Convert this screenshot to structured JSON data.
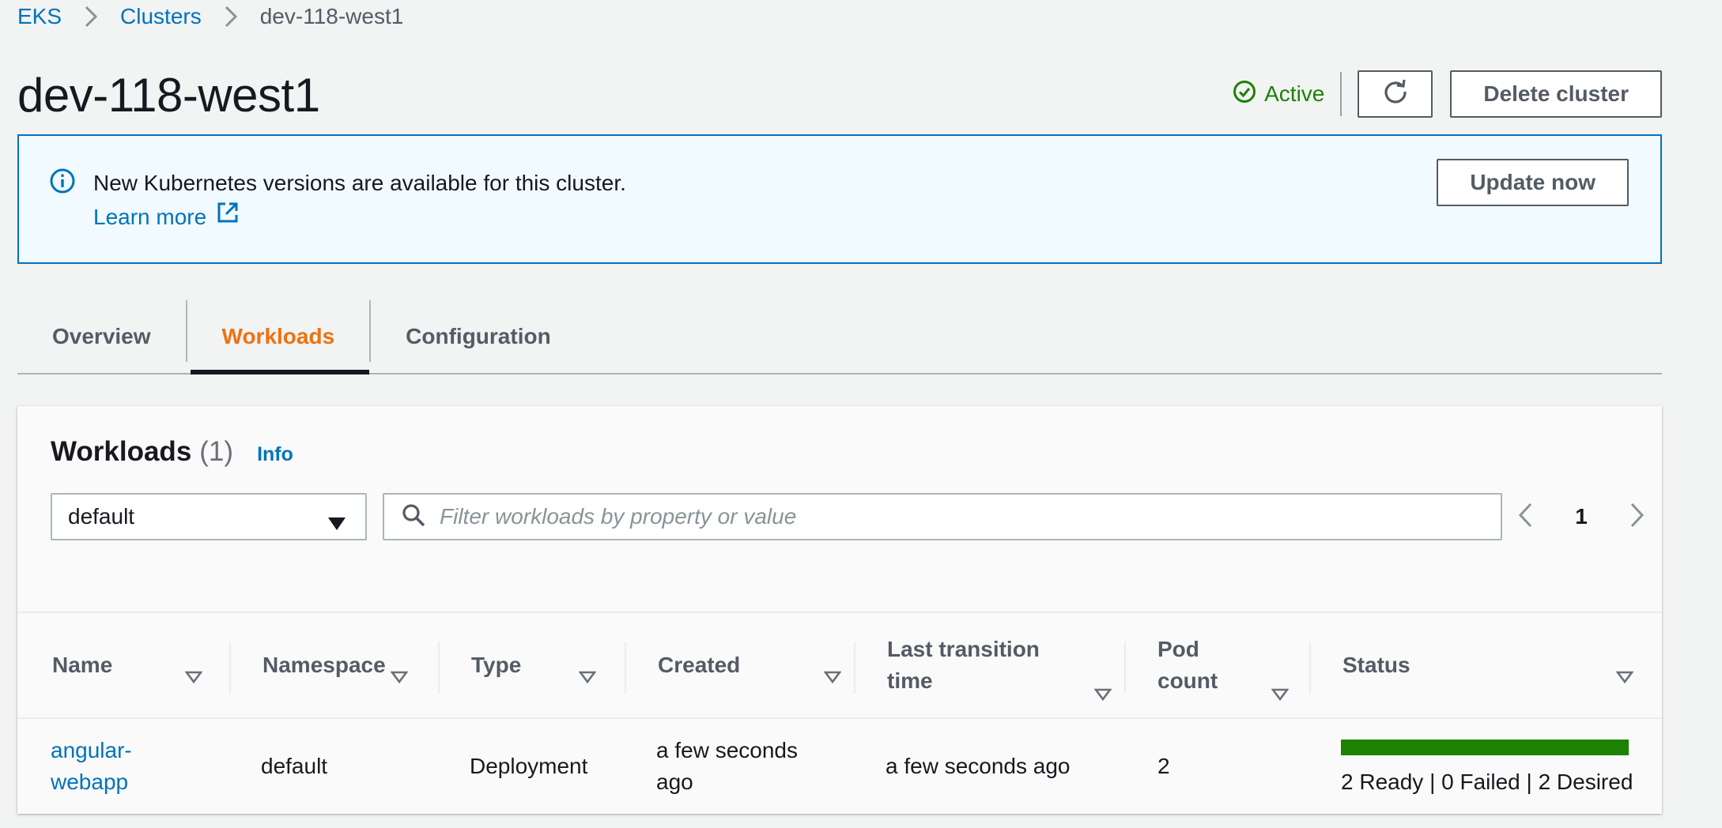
{
  "breadcrumb": {
    "items": [
      "EKS",
      "Clusters"
    ],
    "current": "dev-118-west1"
  },
  "header": {
    "title": "dev-118-west1",
    "status": "Active",
    "delete_label": "Delete cluster"
  },
  "banner": {
    "message": "New Kubernetes versions are available for this cluster.",
    "link": "Learn more",
    "button": "Update now"
  },
  "tabs": [
    {
      "label": "Overview",
      "active": false
    },
    {
      "label": "Workloads",
      "active": true
    },
    {
      "label": "Configuration",
      "active": false
    }
  ],
  "workloads": {
    "title": "Workloads",
    "count": "(1)",
    "info": "Info",
    "namespace_selected": "default",
    "filter_placeholder": "Filter workloads by property or value",
    "page": "1",
    "columns": {
      "name": "Name",
      "namespace": "Namespace",
      "type": "Type",
      "created": "Created",
      "last_transition_1": "Last transition",
      "last_transition_2": "time",
      "pod_count_1": "Pod",
      "pod_count_2": "count",
      "status": "Status"
    },
    "rows": [
      {
        "name_1": "angular-",
        "name_2": "webapp",
        "namespace": "default",
        "type": "Deployment",
        "created_1": "a few seconds",
        "created_2": "ago",
        "last_transition": "a few seconds ago",
        "pod_count": "2",
        "status_text": "2 Ready | 0 Failed | 2 Desired",
        "ready_fraction": 1.0
      }
    ]
  },
  "icons": {
    "breadcrumb_separator": "chevron-right-icon",
    "status": "check-circle-icon",
    "refresh": "refresh-icon",
    "info": "info-circle-icon",
    "external": "external-link-icon",
    "dropdown": "caret-down-icon",
    "search": "search-icon",
    "prev": "chevron-left-icon",
    "next": "chevron-right-icon",
    "sort": "sort-caret-icon"
  },
  "colors": {
    "link": "#0073bb",
    "success": "#1d8102",
    "tab_active": "#ec7211",
    "banner_bg": "#f1faff"
  }
}
